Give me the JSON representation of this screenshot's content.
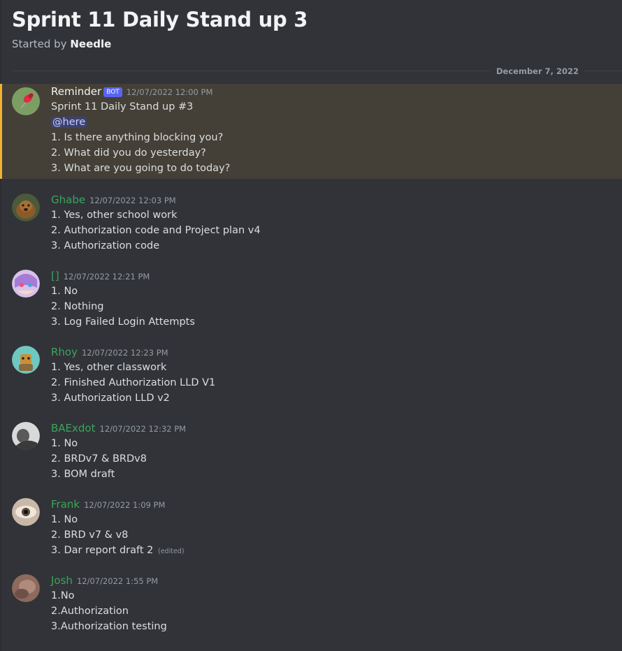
{
  "thread": {
    "title": "Sprint 11 Daily Stand up 3",
    "started_by_prefix": "Started by",
    "started_by_name": "Needle",
    "date_divider": "December 7, 2022"
  },
  "colors": {
    "background": "#313338",
    "highlight": "#444037",
    "highlight_border": "#f0b232",
    "author_green": "#3ba55c",
    "bot_tag": "#5865f2",
    "mention_bg": "#3c4270"
  },
  "messages": [
    {
      "author": "Reminder",
      "bot_tag": "BOT",
      "timestamp": "12/07/2022 12:00 PM",
      "avatar_icon": "pushpin-icon",
      "lines": [
        "Sprint 11 Daily Stand up #3",
        "@here",
        "1. Is there anything blocking you?",
        "2. What did you do yesterday?",
        "3. What are you going to do today?"
      ]
    },
    {
      "author": "Ghabe",
      "timestamp": "12/07/2022 12:03 PM",
      "lines": [
        "1. Yes, other school work",
        "2. Authorization code and Project plan v4",
        "3. Authorization code"
      ]
    },
    {
      "author": "[]",
      "timestamp": "12/07/2022 12:21 PM",
      "lines": [
        "1. No",
        "2. Nothing",
        "3. Log Failed Login Attempts"
      ]
    },
    {
      "author": "Rhoy",
      "timestamp": "12/07/2022 12:23 PM",
      "lines": [
        "1. Yes, other classwork",
        "2. Finished Authorization LLD V1",
        "3. Authorization LLD v2"
      ]
    },
    {
      "author": "BAExdot",
      "timestamp": "12/07/2022 12:32 PM",
      "lines": [
        "1. No",
        "2. BRDv7 & BRDv8",
        "3. BOM draft"
      ]
    },
    {
      "author": "Frank",
      "timestamp": "12/07/2022 1:09 PM",
      "lines": [
        "1. No",
        "2. BRD v7 & v8",
        "3. Dar report draft 2"
      ],
      "edited_label": "(edited)"
    },
    {
      "author": "Josh",
      "timestamp": "12/07/2022 1:55 PM",
      "lines": [
        "1.No",
        "2.Authorization",
        "3.Authorization testing"
      ]
    }
  ]
}
